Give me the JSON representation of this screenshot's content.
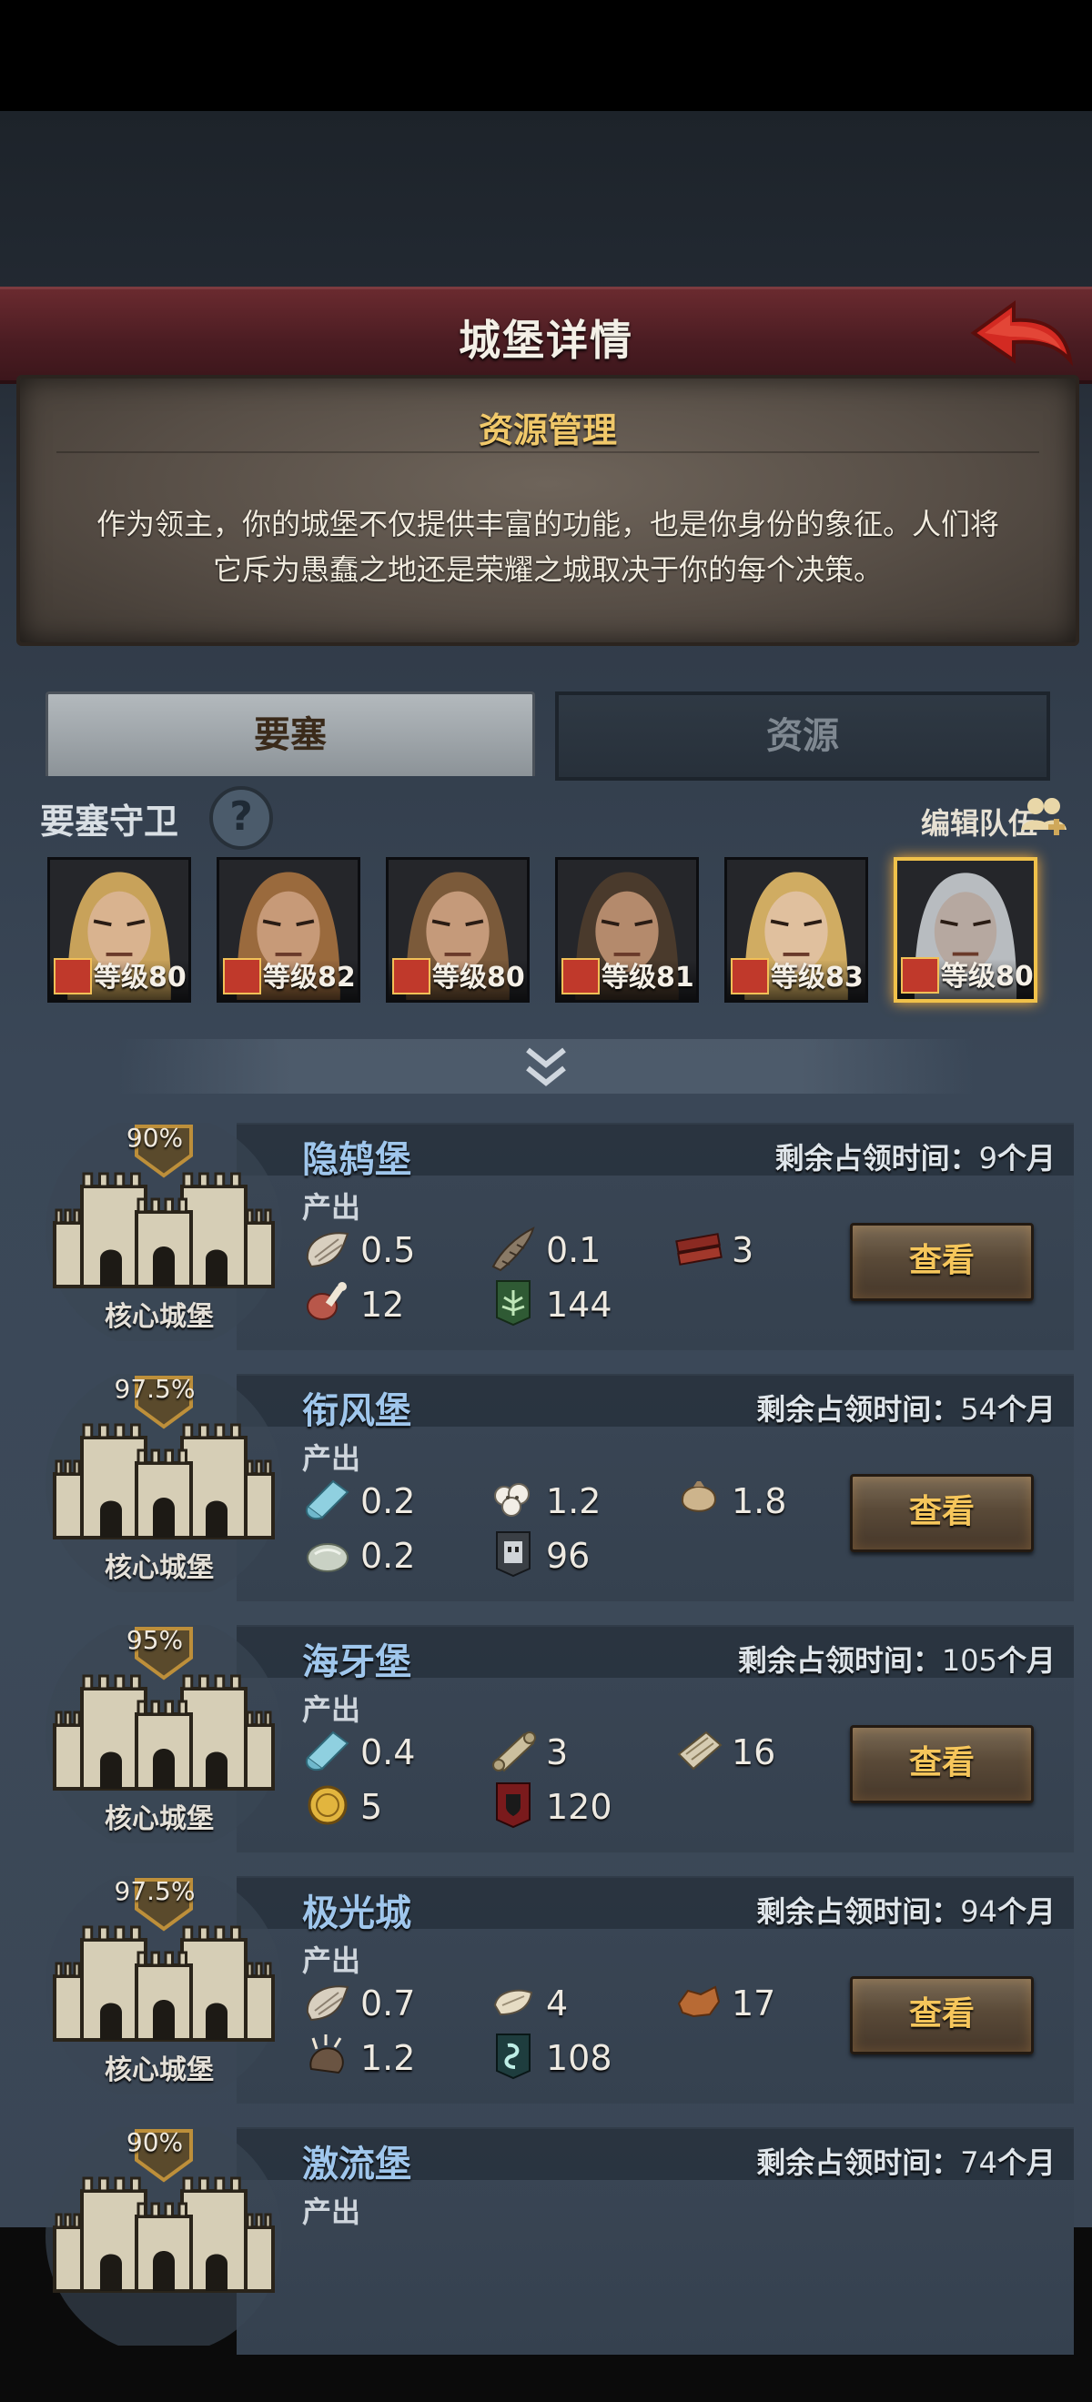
{
  "header": {
    "title": "城堡详情"
  },
  "info": {
    "title": "资源管理",
    "text_line1": "作为领主，你的城堡不仅提供丰富的功能，也是你身份的象征。人们将",
    "text_line2": "它斥为愚蠢之地还是荣耀之城取决于你的每个决策。"
  },
  "tabs": [
    {
      "label": "要塞"
    },
    {
      "label": "资源"
    }
  ],
  "guards": {
    "label": "要塞守卫",
    "help": "?",
    "edit_label": "编辑队伍",
    "heroes": [
      {
        "level": "等级80",
        "hair": "#c8a25a",
        "skin": "#d9b38f"
      },
      {
        "level": "等级82",
        "hair": "#9a6a3d",
        "skin": "#c79a78"
      },
      {
        "level": "等级80",
        "hair": "#7b5a3a",
        "skin": "#c59a7a"
      },
      {
        "level": "等级81",
        "hair": "#4a3a2c",
        "skin": "#b48a6c"
      },
      {
        "level": "等级83",
        "hair": "#d0ac62",
        "skin": "#e0c09e"
      },
      {
        "level": "等级80",
        "hair": "#b8bcc0",
        "skin": "#b6a8a0",
        "selected": true
      }
    ]
  },
  "castles": [
    {
      "name": "隐鸫堡",
      "percent": "90%",
      "core": "核心城堡",
      "occupy_label": "剩余占领时间：",
      "occupy_num": "9",
      "occupy_unit": "个月",
      "output": "产出",
      "resources": [
        {
          "icon": "fur-icon",
          "value": "0.5"
        },
        {
          "icon": "horn-icon",
          "value": "0.1"
        },
        {
          "icon": "wood-icon",
          "value": "3"
        },
        {
          "icon": "meat-icon",
          "value": "12"
        },
        {
          "icon": "banner-tree-icon",
          "value": "144"
        }
      ],
      "button": "查看"
    },
    {
      "name": "衔风堡",
      "percent": "97.5%",
      "core": "核心城堡",
      "occupy_label": "剩余占领时间：",
      "occupy_num": "54",
      "occupy_unit": "个月",
      "output": "产出",
      "resources": [
        {
          "icon": "cloth-icon",
          "value": "0.2"
        },
        {
          "icon": "cotton-icon",
          "value": "1.2"
        },
        {
          "icon": "sack-icon",
          "value": "1.8"
        },
        {
          "icon": "stone-icon",
          "value": "0.2"
        },
        {
          "icon": "banner-mask-icon",
          "value": "96"
        }
      ],
      "button": "查看"
    },
    {
      "name": "海牙堡",
      "percent": "95%",
      "core": "核心城堡",
      "occupy_label": "剩余占领时间：",
      "occupy_num": "105",
      "occupy_unit": "个月",
      "output": "产出",
      "resources": [
        {
          "icon": "cloth-icon",
          "value": "0.4"
        },
        {
          "icon": "scroll-icon",
          "value": "3"
        },
        {
          "icon": "parchment-icon",
          "value": "16"
        },
        {
          "icon": "coin-icon",
          "value": "5"
        },
        {
          "icon": "banner-shield-icon",
          "value": "120"
        }
      ],
      "button": "查看"
    },
    {
      "name": "极光城",
      "percent": "97.5%",
      "core": "核心城堡",
      "occupy_label": "剩余占领时间：",
      "occupy_num": "94",
      "occupy_unit": "个月",
      "output": "产出",
      "resources": [
        {
          "icon": "fur-icon",
          "value": "0.7"
        },
        {
          "icon": "hide-icon",
          "value": "4"
        },
        {
          "icon": "leather-icon",
          "value": "17"
        },
        {
          "icon": "claw-icon",
          "value": "1.2"
        },
        {
          "icon": "banner-serpent-icon",
          "value": "108"
        }
      ],
      "button": "查看"
    },
    {
      "name": "激流堡",
      "percent": "90%",
      "core": "",
      "occupy_label": "剩余占领时间：",
      "occupy_num": "74",
      "occupy_unit": "个月",
      "output": "产出",
      "resources": [],
      "button": ""
    }
  ],
  "colors": {
    "accent_gold": "#f0c14a",
    "castle_name": "#9fc6ec",
    "header_red": "#5a2328"
  }
}
